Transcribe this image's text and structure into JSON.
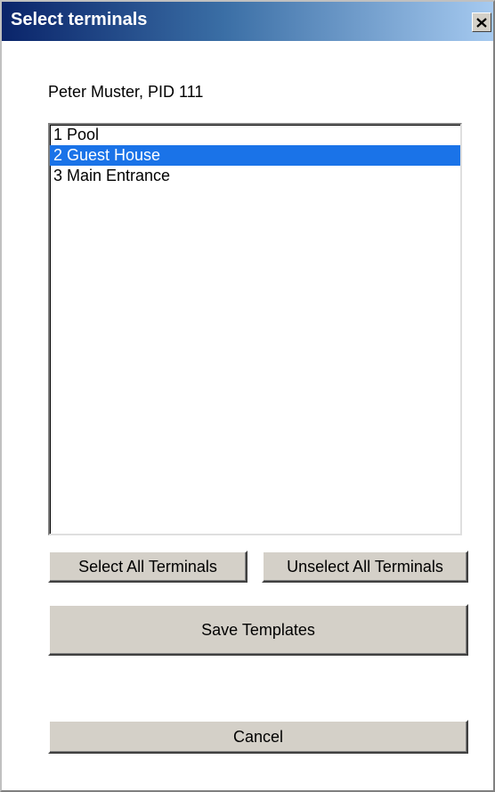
{
  "window": {
    "title": "Select terminals",
    "close_label": "close"
  },
  "user_label": "Peter Muster, PID 111",
  "terminals": {
    "items": [
      {
        "label": "1 Pool",
        "selected": false
      },
      {
        "label": "2 Guest House",
        "selected": true
      },
      {
        "label": "3 Main Entrance",
        "selected": false
      }
    ]
  },
  "buttons": {
    "select_all": "Select All Terminals",
    "unselect_all": "Unselect All Terminals",
    "save": "Save Templates",
    "cancel": "Cancel"
  },
  "colors": {
    "selection": "#1a73e8",
    "titlebar_start": "#0a246a",
    "button_face": "#d4d0c8"
  }
}
